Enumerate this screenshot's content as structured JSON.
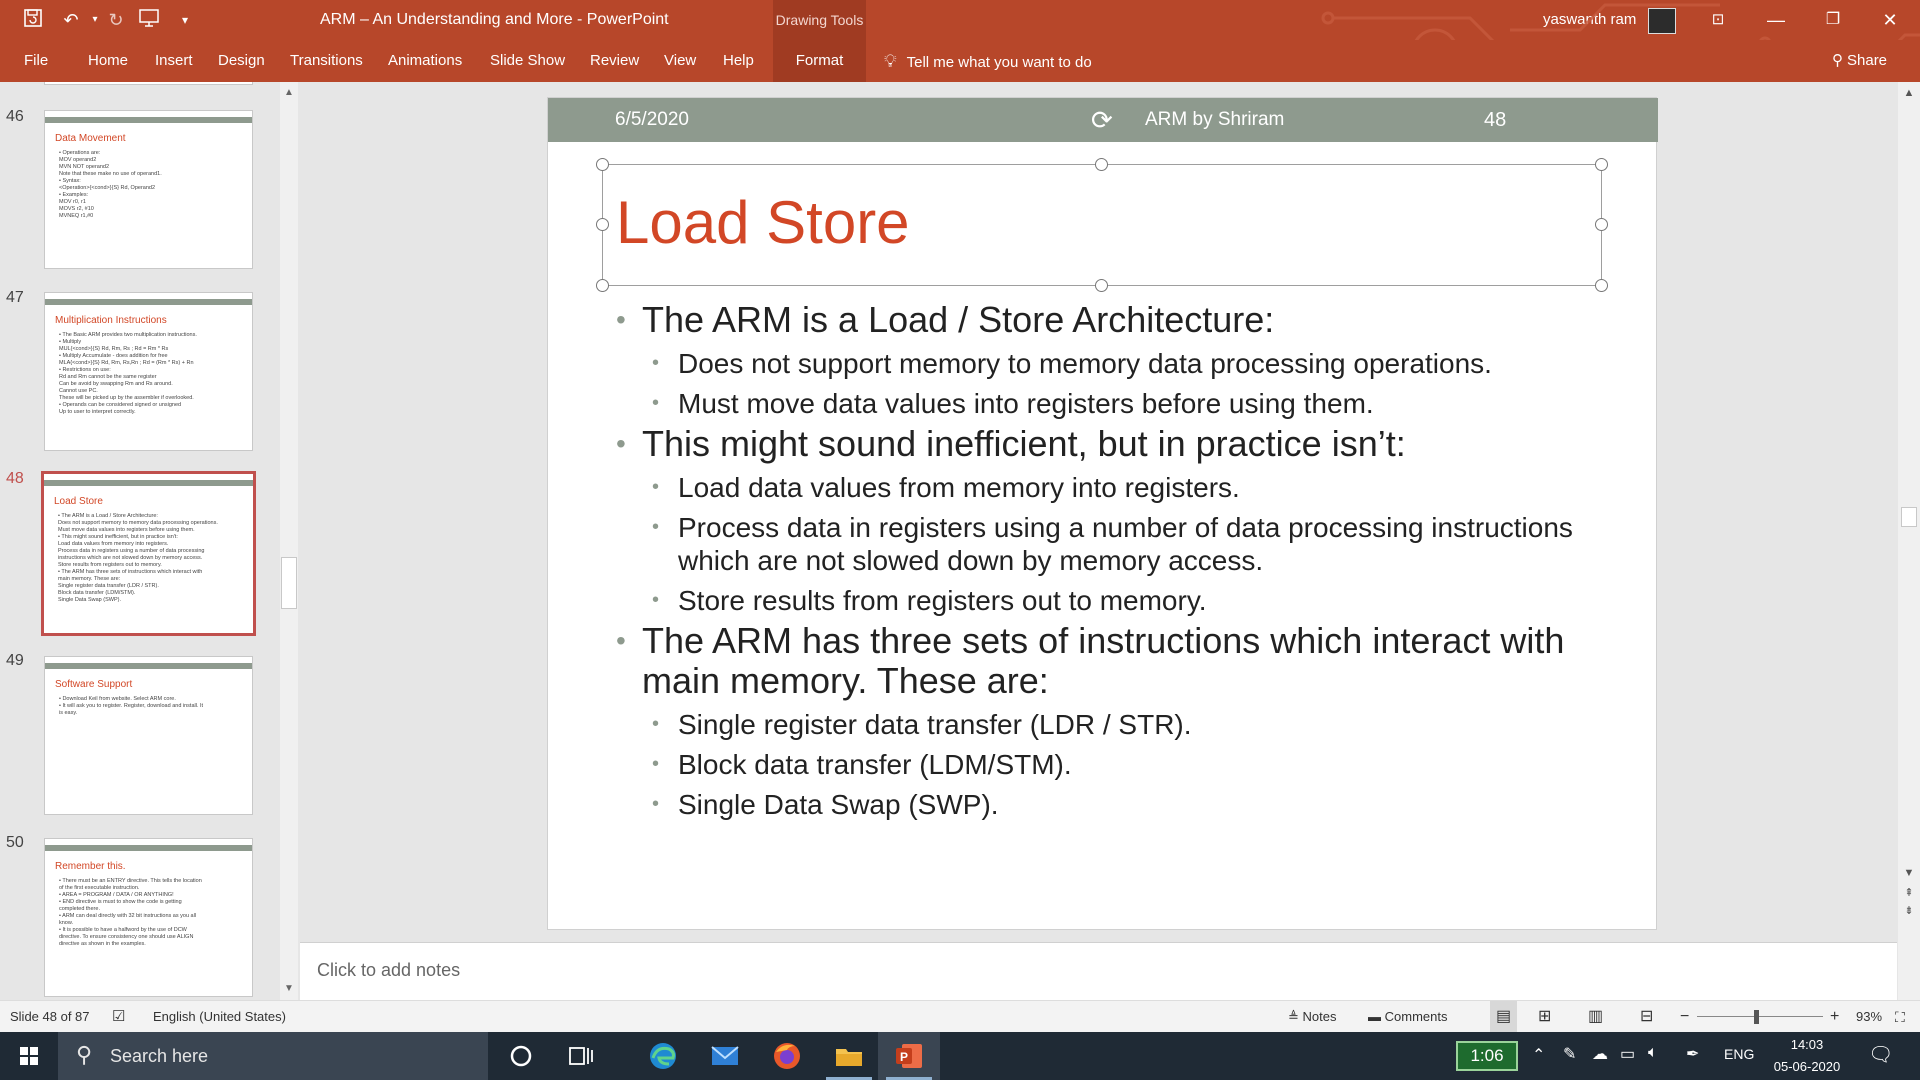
{
  "window": {
    "title": "ARM – An Understanding and More  -  PowerPoint",
    "contextual_tab_group": "Drawing Tools",
    "user": "yaswanth ram"
  },
  "ribbon": {
    "tabs": [
      "File",
      "Home",
      "Insert",
      "Design",
      "Transitions",
      "Animations",
      "Slide Show",
      "Review",
      "View",
      "Help",
      "Format"
    ],
    "tell_me": "Tell me what you want to do",
    "share": "Share"
  },
  "thumbnails": [
    {
      "number": "46",
      "title": "Data Movement",
      "lines": [
        "• Operations are:",
        "    MOV     operand2",
        "    MVN     NOT operand2",
        "  Note that these make no use of operand1.",
        "• Syntax:",
        "    <Operation>{<cond>}{S} Rd, Operand2",
        "• Examples:",
        "    MOV     r0, r1",
        "    MOVS    r2, #10",
        "    MVNEQ   r1,#0"
      ]
    },
    {
      "number": "47",
      "title": "Multiplication  Instructions",
      "lines": [
        "• The Basic ARM provides two multiplication instructions.",
        "• Multiply",
        "    MUL{<cond>}{S} Rd, Rm, Rs        ; Rd = Rm * Rs",
        "• Multiply Accumulate     - does addition for free",
        "    MLA{<cond>}{S} Rd, Rm, Rs,Rn    ; Rd = (Rm * Rs) + Rn",
        "• Restrictions on use:",
        "    Rd and Rm cannot be the same register",
        "    Can be avoid by swapping Rm and Rs around.",
        "    Cannot use PC.",
        "  These will be picked up by the assembler if overlooked.",
        "• Operands can be considered signed or unsigned",
        "    Up to user to interpret correctly."
      ]
    },
    {
      "number": "48",
      "title": "Load Store",
      "lines": [
        "• The ARM is a Load / Store Architecture:",
        "    Does not support memory to memory data processing operations.",
        "    Must move data values into registers before using them.",
        "• This might sound inefficient, but in practice isn't:",
        "    Load data values from memory into registers.",
        "    Process data in registers using a number of data processing",
        "    instructions which are not slowed down by memory access.",
        "    Store results from registers out to memory.",
        "• The ARM has three sets of instructions which interact with",
        "  main memory. These are:",
        "    Single register data transfer (LDR / STR).",
        "    Block data transfer (LDM/STM).",
        "    Single Data Swap (SWP)."
      ]
    },
    {
      "number": "49",
      "title": "Software Support",
      "lines": [
        "• Download Keil from website. Select ARM core.",
        "• It will ask you to register. Register, download and install. It",
        "  is easy."
      ]
    },
    {
      "number": "50",
      "title": "Remember  this.",
      "lines": [
        "• There must be an ENTRY directive. This tells the location",
        "  of the first executable instruction.",
        "• AREA  = PROGRAM / DATA / OR ANYTHING!",
        "• END directive is must to show the code is getting",
        "  completed there.",
        "• ARM can deal directly with 32 bit instructions as you all",
        "  know.",
        "• It is possible to have a halfword by the use of DCW",
        "  directive. To ensure consistency one should use ALIGN",
        "  directive as shown in the examples."
      ]
    }
  ],
  "slide": {
    "header": {
      "date": "6/5/2020",
      "footer": "ARM by Shriram",
      "number": "48"
    },
    "title": "Load Store",
    "bullets": [
      {
        "text": "The ARM is a Load / Store Architecture:",
        "sub": [
          "Does not support memory to memory data processing operations.",
          "Must move data values into registers before using them."
        ]
      },
      {
        "text": "This might sound inefficient,  but in practice isn’t:",
        "sub": [
          "Load data values from memory into registers.",
          "Process data in registers using a number of data processing instructions which are not slowed down by memory access.",
          "Store results from registers out to memory."
        ]
      },
      {
        "text": "The ARM has three sets of instructions which interact with main memory. These are:",
        "sub": [
          "Single register data transfer (LDR / STR).",
          "Block data transfer (LDM/STM).",
          "Single Data Swap (SWP)."
        ]
      }
    ]
  },
  "notes": {
    "placeholder": "Click to add notes"
  },
  "status": {
    "slide_info": "Slide 48 of 87",
    "language": "English (United States)",
    "notes": "Notes",
    "comments": "Comments",
    "zoom": "93%",
    "zoom_level": 0.47
  },
  "taskbar": {
    "search_placeholder": "Search here",
    "timer": "1:06",
    "lang": "ENG",
    "time": "14:03",
    "date": "05-06-2020"
  },
  "colors": {
    "accent": "#b7472a",
    "title_red": "#d24726",
    "slide_header": "#8e9a8e"
  }
}
